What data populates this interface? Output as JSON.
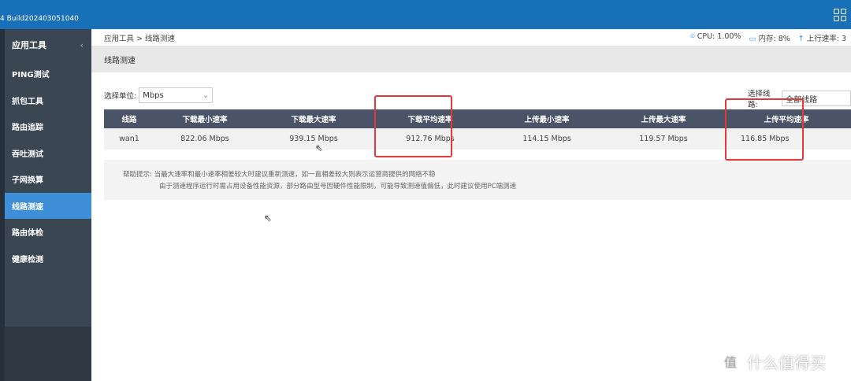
{
  "topbar": {
    "build": "4 Build202403051040"
  },
  "sidebar": {
    "title": "应用工具",
    "items": [
      {
        "label": "PING测试"
      },
      {
        "label": "抓包工具"
      },
      {
        "label": "路由追踪"
      },
      {
        "label": "吞吐测试"
      },
      {
        "label": "子网换算"
      },
      {
        "label": "线路测速",
        "active": true
      },
      {
        "label": "路由体检"
      },
      {
        "label": "健康检测"
      }
    ]
  },
  "breadcrumb": "应用工具 > 线路测速",
  "stats": {
    "cpu": "CPU: 1.00%",
    "mem": "内存: 8%",
    "up": "上行速率: 3"
  },
  "page_title": "线路测速",
  "unit": {
    "label": "选择单位:",
    "value": "Mbps"
  },
  "line": {
    "label": "选择线路:",
    "value": "全部线路"
  },
  "table": {
    "headers": [
      "线路",
      "下载最小速率",
      "下载最大速率",
      "下载平均速率",
      "上传最小速率",
      "上传最大速率",
      "上传平均速率"
    ],
    "rows": [
      [
        "wan1",
        "822.06 Mbps",
        "939.15 Mbps",
        "912.76 Mbps",
        "114.15 Mbps",
        "119.57 Mbps",
        "116.85 Mbps"
      ]
    ]
  },
  "help": {
    "label": "帮助提示:",
    "line1": "当最大速率和最小速率相差较大时建议重新测速，如一直相差较大则表示运营商提供的网络不稳",
    "line2": "由于测速程序运行时需占用设备性能资源，部分路由型号因硬件性能限制，可能导致测速值偏低，此时建议使用PC端测速"
  },
  "watermark": {
    "text": "什么值得买",
    "logo": "值"
  },
  "colors": {
    "topbar": "#1770b8",
    "active": "#3e8fd8",
    "highlight": "#e53838"
  }
}
